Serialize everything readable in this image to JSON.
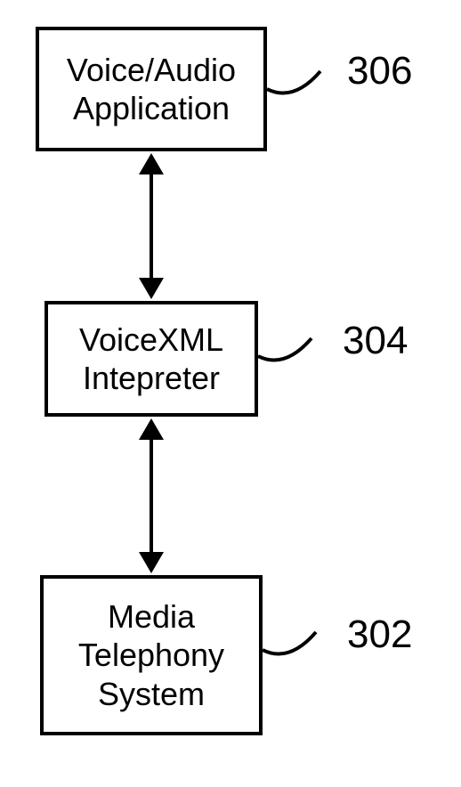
{
  "diagram": {
    "boxes": {
      "top": {
        "line1": "Voice/Audio",
        "line2": "Application",
        "ref": "306"
      },
      "middle": {
        "line1": "VoiceXML",
        "line2": "Intepreter",
        "ref": "304"
      },
      "bottom": {
        "line1": "Media",
        "line2": "Telephony",
        "line3": "System",
        "ref": "302"
      }
    }
  },
  "chart_data": {
    "type": "diagram",
    "nodes": [
      {
        "id": "306",
        "label": "Voice/Audio Application"
      },
      {
        "id": "304",
        "label": "VoiceXML Intepreter"
      },
      {
        "id": "302",
        "label": "Media Telephony System"
      }
    ],
    "edges": [
      {
        "from": "306",
        "to": "304",
        "bidirectional": true
      },
      {
        "from": "304",
        "to": "302",
        "bidirectional": true
      }
    ]
  }
}
